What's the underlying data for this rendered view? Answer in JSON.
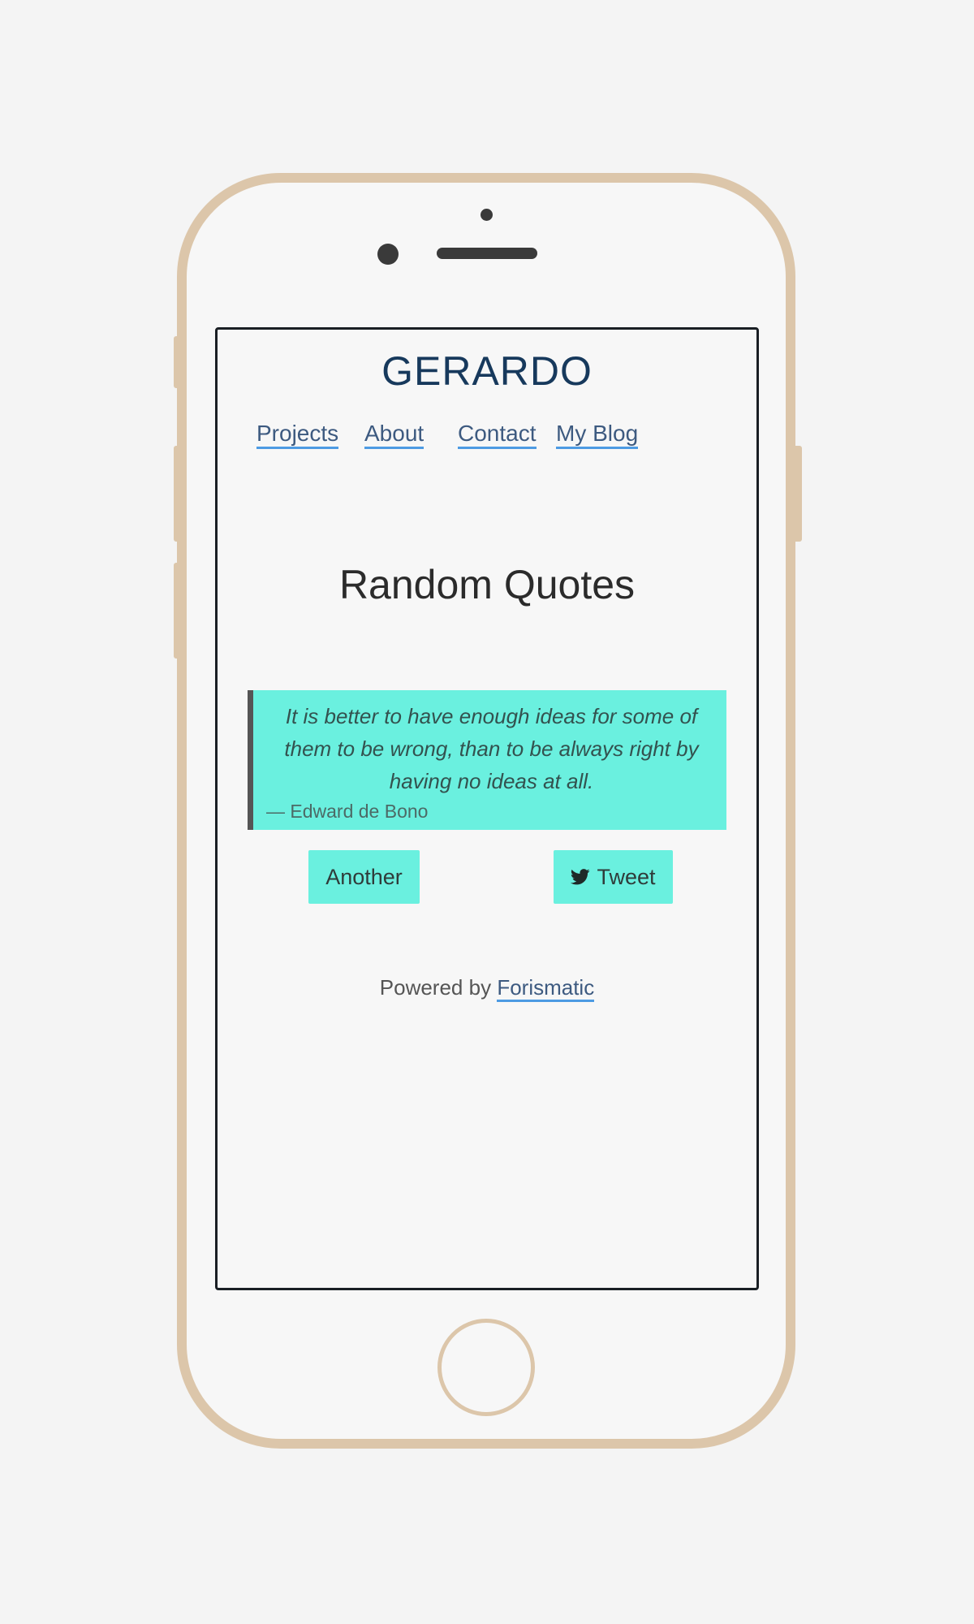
{
  "site": {
    "title": "GERARDO"
  },
  "nav": {
    "items": [
      {
        "label": "Projects"
      },
      {
        "label": "About"
      },
      {
        "label": "Contact"
      },
      {
        "label": "My Blog"
      }
    ]
  },
  "main": {
    "heading": "Random Quotes",
    "quote": {
      "text": "It is better to have enough ideas for some of them to be wrong, than to be always right by having no ideas at all.",
      "author": "— Edward de Bono"
    },
    "buttons": {
      "another_label": "Another",
      "tweet_label": "Tweet"
    }
  },
  "footer": {
    "powered_by": "Powered by",
    "link_label": "Forismatic"
  },
  "colors": {
    "accent": "#6af0df",
    "link": "#3d5a80",
    "link_underline": "#4d9be3",
    "title": "#17395c",
    "phone_frame": "#dcc6aa"
  },
  "icons": {
    "tweet_button": "twitter-icon"
  }
}
